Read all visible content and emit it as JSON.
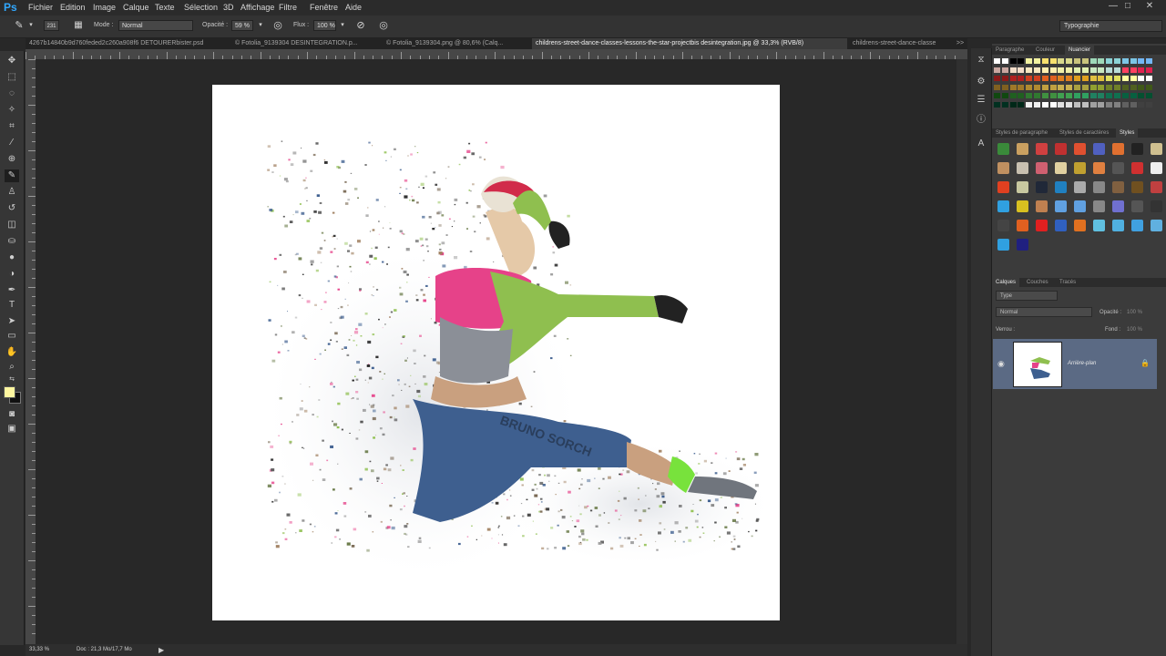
{
  "app": {
    "logo": "Ps",
    "accent": "#31a8ff"
  },
  "menu": [
    "Fichier",
    "Edition",
    "Image",
    "Calque",
    "Texte",
    "Sélection",
    "3D",
    "Affichage",
    "Filtre",
    "Fenêtre",
    "Aide"
  ],
  "window_controls": [
    "—",
    "□",
    "✕"
  ],
  "options": {
    "brush_size": "231",
    "mode_label": "Mode :",
    "mode_value": "Normal",
    "opacity_label": "Opacité :",
    "opacity_value": "59 %",
    "flow_label": "Flux :",
    "flow_value": "100 %",
    "workspace": "Typographie"
  },
  "tabs": [
    {
      "label": "4267b14840b9d760feded2c260a908f6 DETOURERbister.psd"
    },
    {
      "label": "© Fotolia_9139304 DESINTEGRATION.p..."
    },
    {
      "label": "© Fotolia_9139304.png @ 80,6% (Calq..."
    },
    {
      "label": "childrens-street-dance-classes-lessons-the-star-projectbis desintegration.jpg @ 33,3% (RVB/8)"
    },
    {
      "label": "childrens-street-dance-classe"
    }
  ],
  "tab_overflow": ">>",
  "status": {
    "zoom": "33,33 %",
    "doc": "Doc : 21,3 Mo/17,7 Mo"
  },
  "artwork": {
    "watermark": "BRUNO SORCH"
  },
  "panels": {
    "top_tabs": [
      "Paragraphe",
      "Couleur",
      "Nuancier"
    ],
    "style_tabs": [
      "Styles de paragraphe",
      "Styles de caractères",
      "Styles"
    ],
    "layer_tabs": [
      "Calques",
      "Couches",
      "Tracés"
    ],
    "layers": {
      "filter": "Type",
      "blend": "Normal",
      "opacity_label": "Opacité :",
      "opacity_value": "100 %",
      "lock_label": "Verrou :",
      "fill_label": "Fond :",
      "fill_value": "100 %",
      "items": [
        {
          "name": "Arrière-plan"
        }
      ]
    }
  },
  "colors": {
    "foreground": "#fff7a0",
    "background": "#111111",
    "layer_selected": "#5b6a84"
  }
}
